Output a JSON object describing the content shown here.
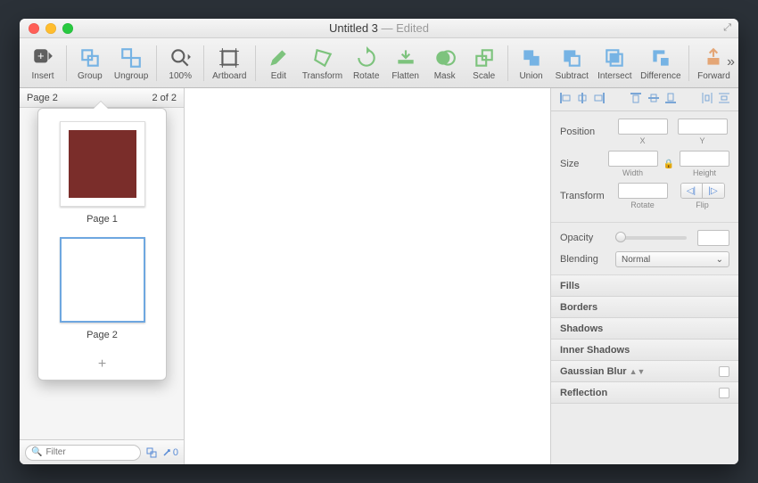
{
  "window": {
    "title": "Untitled 3",
    "edited": " — Edited"
  },
  "toolbar": {
    "insert": "Insert",
    "group": "Group",
    "ungroup": "Ungroup",
    "zoom": "100%",
    "artboard": "Artboard",
    "edit": "Edit",
    "transform": "Transform",
    "rotate": "Rotate",
    "flatten": "Flatten",
    "mask": "Mask",
    "scale": "Scale",
    "union": "Union",
    "subtract": "Subtract",
    "intersect": "Intersect",
    "difference": "Difference",
    "forward": "Forward"
  },
  "sidebar": {
    "current_page": "Page 2",
    "page_count": "2 of 2",
    "pages": [
      {
        "label": "Page 1",
        "swatch": "#7a2d2a",
        "selected": false
      },
      {
        "label": "Page 2",
        "swatch": "#ffffff",
        "selected": true
      }
    ],
    "filter_placeholder": "Filter",
    "layer_count": "0"
  },
  "inspector": {
    "position_label": "Position",
    "x_label": "X",
    "y_label": "Y",
    "size_label": "Size",
    "width_label": "Width",
    "height_label": "Height",
    "transform_label": "Transform",
    "rotate_label": "Rotate",
    "flip_label": "Flip",
    "opacity_label": "Opacity",
    "blending_label": "Blending",
    "blending_value": "Normal",
    "panels": {
      "fills": "Fills",
      "borders": "Borders",
      "shadows": "Shadows",
      "inner_shadows": "Inner Shadows",
      "gaussian_blur": "Gaussian Blur",
      "reflection": "Reflection"
    }
  }
}
